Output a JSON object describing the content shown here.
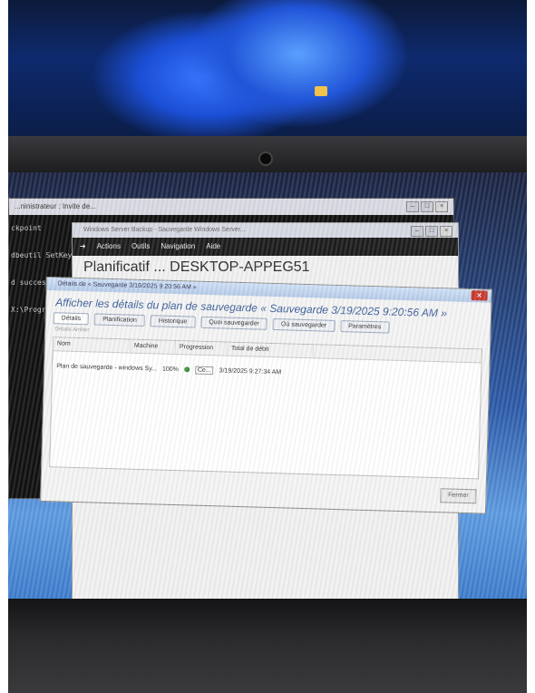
{
  "cmd": {
    "title": "...ninistrateur : Invite de...",
    "lines": [
      "ckpoint",
      "dbeutil SetKey",
      "d successfull",
      "X:\\Program"
    ]
  },
  "mmc": {
    "title": "Windows Server Backup - Sauvegarde Windows Server...",
    "menu": [
      "Actions",
      "Outils",
      "Navigation",
      "Aide"
    ],
    "header": "Planificatif ... DESKTOP-APPEG51"
  },
  "dialog": {
    "title": "Détails de « Sauvegarde 3/19/2025 9:20:56 AM »",
    "heading": "Afficher les détails du plan de sauvegarde « Sauvegarde 3/19/2025 9:20:56 AM »",
    "tabs": [
      "Détails",
      "Planification",
      "Historique",
      "Quoi sauvegarder",
      "Où sauvegarder",
      "Paramètres"
    ],
    "sub": "Détails    Arrêter",
    "columns": [
      "Nom",
      "Machine",
      "Progression",
      "Total de débit"
    ],
    "row": {
      "name": "Plan de sauvegarde - windows Sy...",
      "progress": "100%",
      "status": "Ce...",
      "date": "3/19/2025 9:27:34 AM"
    },
    "close_label": "Fermer"
  },
  "colors": {
    "accent": "#3c5f9a",
    "close_red": "#c8382d",
    "ok_green": "#3e8e3a"
  }
}
